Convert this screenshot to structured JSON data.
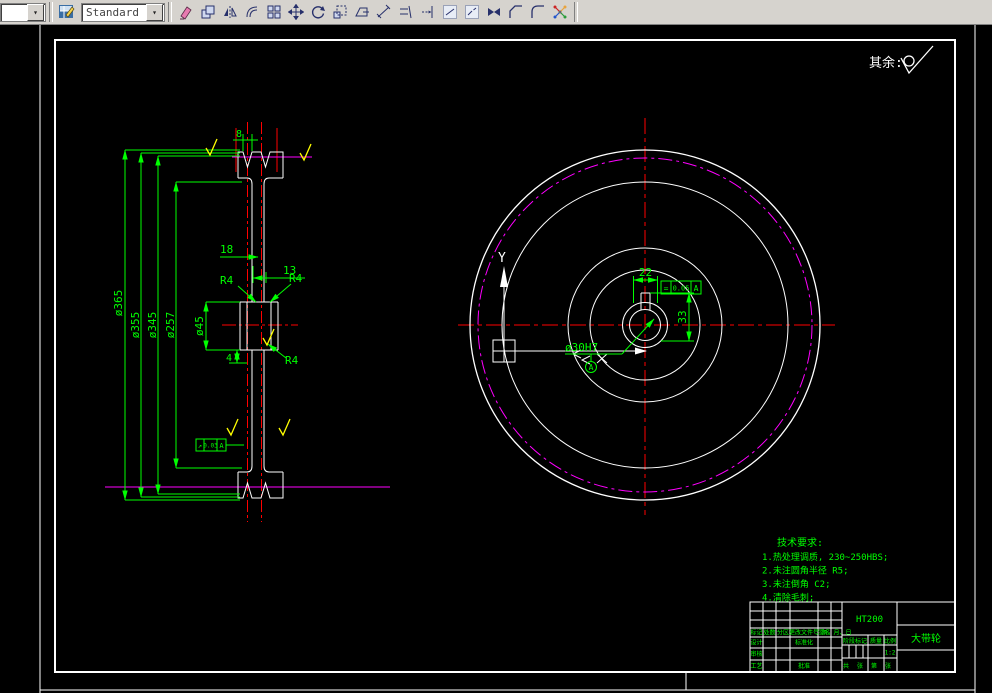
{
  "toolbar": {
    "style_value": "Standard",
    "dropdown_arrow": "▾",
    "icons": [
      "erase",
      "copy",
      "mirror",
      "offset",
      "array",
      "move",
      "rotate",
      "scale",
      "stretch",
      "lengthen",
      "trim",
      "extend",
      "break-at-point",
      "break",
      "join",
      "chamfer",
      "fillet",
      "explode"
    ]
  },
  "colors": {
    "dimension": "#00ff00",
    "outline": "#ffffff",
    "centerline": "#ff0000",
    "pitch_line": "#ff00ff",
    "roughness": "#ffff00"
  },
  "drawing": {
    "surface_note": "其余:",
    "left_view": {
      "dims": {
        "d365": "ø365",
        "d355": "ø355",
        "d345": "ø345",
        "d257": "ø257",
        "d45": "ø45",
        "w18": "18",
        "w13": "13",
        "g8": "8",
        "k4": "4",
        "r4a": "R4",
        "r4b": "R4",
        "r4c": "R4"
      },
      "fcf": {
        "symbol": "↗",
        "value": "0.03",
        "datum": "A"
      }
    },
    "right_view": {
      "ucs_y": "Y",
      "dims": {
        "kw22": "22",
        "kd33": "33",
        "bore": "ø30H7",
        "datum": "A"
      },
      "fcf": {
        "symbol": "=",
        "value": "0.05",
        "datum": "A"
      }
    },
    "tech_req": {
      "title": "技术要求:",
      "items": [
        "1.热处理调质, 230~250HBS;",
        "2.未注圆角半径 R5;",
        "3.未注倒角 C2;",
        "4.清除毛刺;"
      ]
    },
    "title_block": {
      "material": "HT200",
      "part_name": "大带轮",
      "headers": [
        "标记",
        "处数",
        "分区",
        "更改文件号",
        "签名",
        "年、月、日"
      ],
      "row_design": "设计",
      "row_standard": "标准化",
      "row_check": "审核",
      "row_process": "工艺",
      "row_approve": "批准",
      "stage_label": "阶段标记",
      "weight_label": "质量",
      "scale_label": "比例",
      "scale_value": "1:2",
      "sheet": [
        "共",
        "张",
        "第",
        "张"
      ]
    }
  }
}
